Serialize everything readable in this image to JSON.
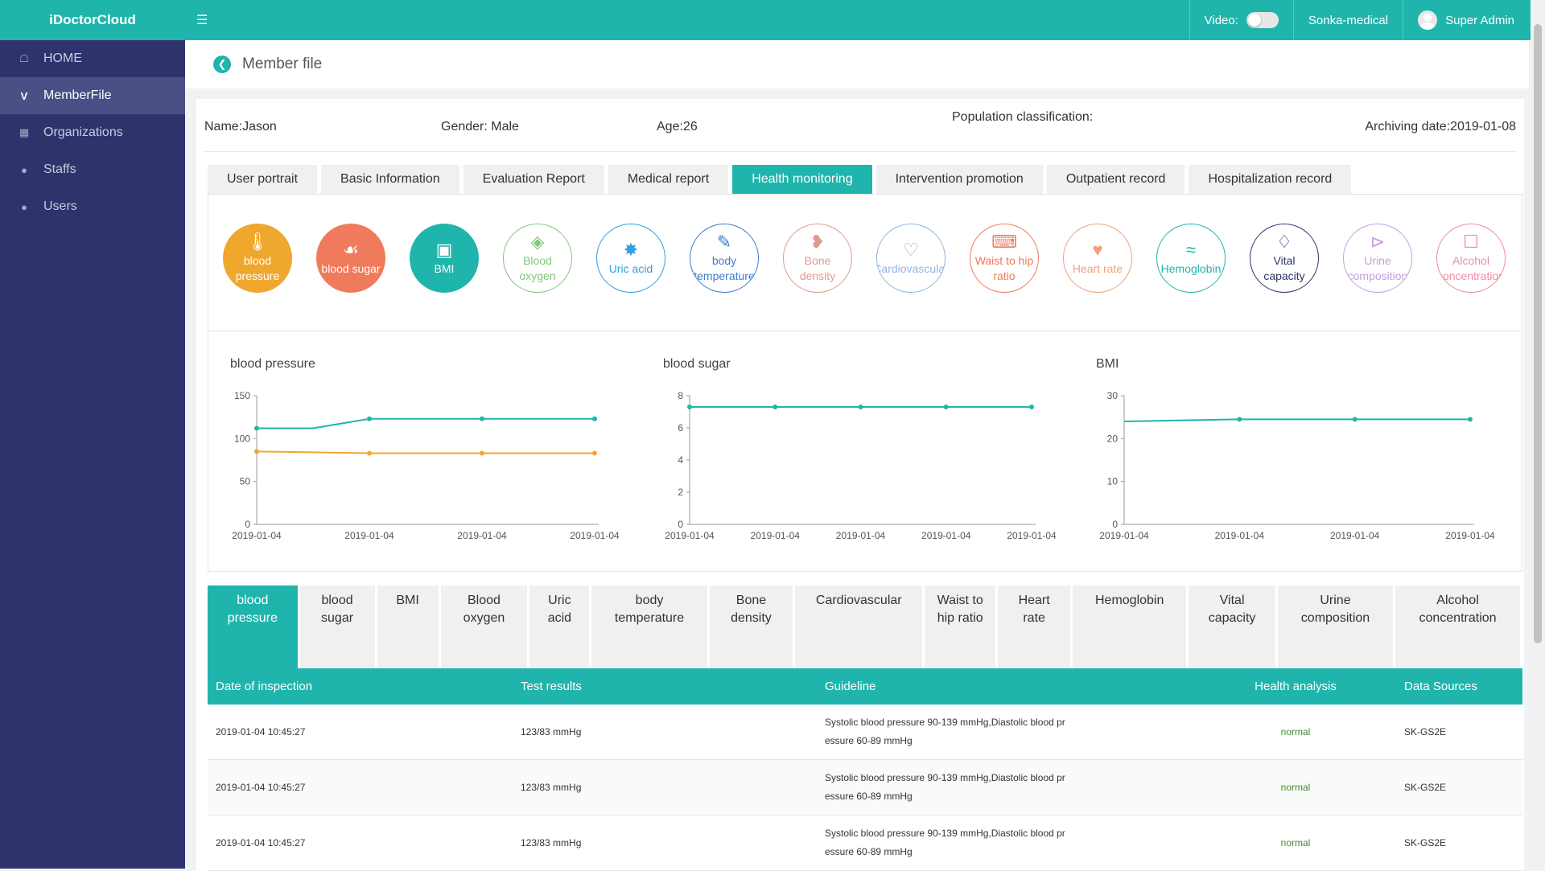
{
  "header": {
    "brand": "iDoctorCloud",
    "video_label": "Video:",
    "org": "Sonka-medical",
    "user": "Super Admin"
  },
  "sidebar": {
    "items": [
      {
        "label": "HOME",
        "icon": "home-icon"
      },
      {
        "label": "MemberFile",
        "icon": "v-logo-icon",
        "active": true
      },
      {
        "label": "Organizations",
        "icon": "building-icon"
      },
      {
        "label": "Staffs",
        "icon": "person-icon"
      },
      {
        "label": "Users",
        "icon": "person-icon"
      }
    ]
  },
  "page": {
    "title": "Member file"
  },
  "member": {
    "name": "Name:Jason",
    "gender": "Gender: Male",
    "age": "Age:26",
    "population": "Population classification:",
    "archiving_date": "Archiving date:2019-01-08"
  },
  "tabs": [
    "User portrait",
    "Basic Information",
    "Evaluation Report",
    "Medical report",
    "Health monitoring",
    "Intervention promotion",
    "Outpatient record",
    "Hospitalization record"
  ],
  "active_tab": "Health monitoring",
  "metrics": [
    {
      "label": "blood pressure",
      "color": "#f0a72e",
      "filled": true,
      "icon": "thermometer-icon"
    },
    {
      "label": "blood sugar",
      "color": "#f07a5c",
      "filled": true,
      "icon": "drop-plus-icon"
    },
    {
      "label": "BMI",
      "color": "#1fb5ac",
      "filled": true,
      "icon": "scale-icon"
    },
    {
      "label": "Blood oxygen",
      "color": "#7dc97a",
      "filled": false,
      "icon": "o2-drop-icon"
    },
    {
      "label": "Uric acid",
      "color": "#2f9fe0",
      "filled": false,
      "icon": "molecule-icon"
    },
    {
      "label": "body temperature",
      "color": "#3b7bd4",
      "filled": false,
      "icon": "pen-thermo-icon"
    },
    {
      "label": "Bone density",
      "color": "#e09a8a",
      "filled": false,
      "icon": "bone-icon"
    },
    {
      "label": "Cardiovascular",
      "color": "#8fb5e0",
      "filled": false,
      "icon": "heart-icon"
    },
    {
      "label": "Waist to hip ratio",
      "color": "#f07a5c",
      "filled": false,
      "icon": "waist-icon"
    },
    {
      "label": "Heart rate",
      "color": "#f0a07a",
      "filled": false,
      "icon": "heartbeat-icon"
    },
    {
      "label": "Hemoglobin",
      "color": "#1fb5ac",
      "filled": false,
      "icon": "dna-icon"
    },
    {
      "label": "Vital capacity",
      "color": "#2f336b",
      "filled": false,
      "icon": "lungs-icon"
    },
    {
      "label": "Urine composition",
      "color": "#c79ee0",
      "filled": false,
      "icon": "syringe-icon"
    },
    {
      "label": "Alcohol concentration",
      "color": "#f08aa0",
      "filled": false,
      "icon": "bottle-icon"
    }
  ],
  "chart_data": [
    {
      "type": "line",
      "title": "blood pressure",
      "categories": [
        "2019-01-04",
        "2019-01-04",
        "2019-01-04",
        "2019-01-04"
      ],
      "x_labels": [
        "2019-01-04",
        "2019-01-04",
        "2019-01-04",
        "2019-01-04"
      ],
      "y_ticks": [
        0,
        50,
        100,
        150
      ],
      "ylim": [
        0,
        150
      ],
      "series": [
        {
          "color": "#1fb5ac",
          "values": [
            112,
            123,
            123,
            123
          ],
          "x": [
            0,
            1,
            2,
            3
          ],
          "mid": [
            0.5,
            112
          ]
        },
        {
          "color": "#f0a72e",
          "values": [
            85,
            83,
            83,
            83
          ],
          "x": [
            0,
            1,
            2,
            3
          ]
        }
      ],
      "grid": false
    },
    {
      "type": "line",
      "title": "blood sugar",
      "x_labels": [
        "2019-01-04",
        "2019-01-04",
        "2019-01-04",
        "2019-01-04",
        "2019-01-04"
      ],
      "y_ticks": [
        0,
        2,
        4,
        6,
        8
      ],
      "ylim": [
        0,
        8
      ],
      "series": [
        {
          "color": "#1fb5ac",
          "values": [
            7.3,
            7.3,
            7.3,
            7.3,
            7.3
          ],
          "x": [
            0,
            1,
            2,
            3,
            4
          ]
        }
      ],
      "grid": false
    },
    {
      "type": "line",
      "title": "BMI",
      "x_labels": [
        "2019-01-04",
        "2019-01-04",
        "2019-01-04",
        "2019-01-04"
      ],
      "y_ticks": [
        0,
        10,
        20,
        30
      ],
      "ylim": [
        0,
        30
      ],
      "series": [
        {
          "color": "#1fb5ac",
          "values": [
            24,
            24.5,
            24.5,
            24.5
          ],
          "x": [
            0,
            1,
            2,
            3
          ],
          "first_point_hidden": true
        }
      ],
      "grid": false
    }
  ],
  "subtabs": [
    {
      "label": "blood pressure",
      "active": true
    },
    {
      "label": "blood sugar"
    },
    {
      "label": "BMI"
    },
    {
      "label": "Blood oxygen"
    },
    {
      "label": "Uric acid"
    },
    {
      "label": "body temperature"
    },
    {
      "label": "Bone density"
    },
    {
      "label": "Cardiovascular"
    },
    {
      "label": "Waist to hip ratio"
    },
    {
      "label": "Heart rate"
    },
    {
      "label": "Hemoglobin"
    },
    {
      "label": "Vital capacity"
    },
    {
      "label": "Urine composition"
    },
    {
      "label": "Alcohol concentration"
    }
  ],
  "table": {
    "headers": [
      "Date of inspection",
      "Test results",
      "Guideline",
      "Health analysis",
      "Data Sources"
    ],
    "rows": [
      {
        "date": "2019-01-04 10:45:27",
        "result": "123/83 mmHg",
        "guideline_1": "Systolic blood pressure 90-139 mmHg,Diastolic blood pr",
        "guideline_2": "essure 60-89 mmHg",
        "analysis": "normal",
        "source": "SK-GS2E"
      },
      {
        "date": "2019-01-04 10:45:27",
        "result": "123/83 mmHg",
        "guideline_1": "Systolic blood pressure 90-139 mmHg,Diastolic blood pr",
        "guideline_2": "essure 60-89 mmHg",
        "analysis": "normal",
        "source": "SK-GS2E"
      },
      {
        "date": "2019-01-04 10:45:27",
        "result": "123/83 mmHg",
        "guideline_1": "Systolic blood pressure 90-139 mmHg,Diastolic blood pr",
        "guideline_2": "essure 60-89 mmHg",
        "analysis": "normal",
        "source": "SK-GS2E"
      }
    ]
  }
}
